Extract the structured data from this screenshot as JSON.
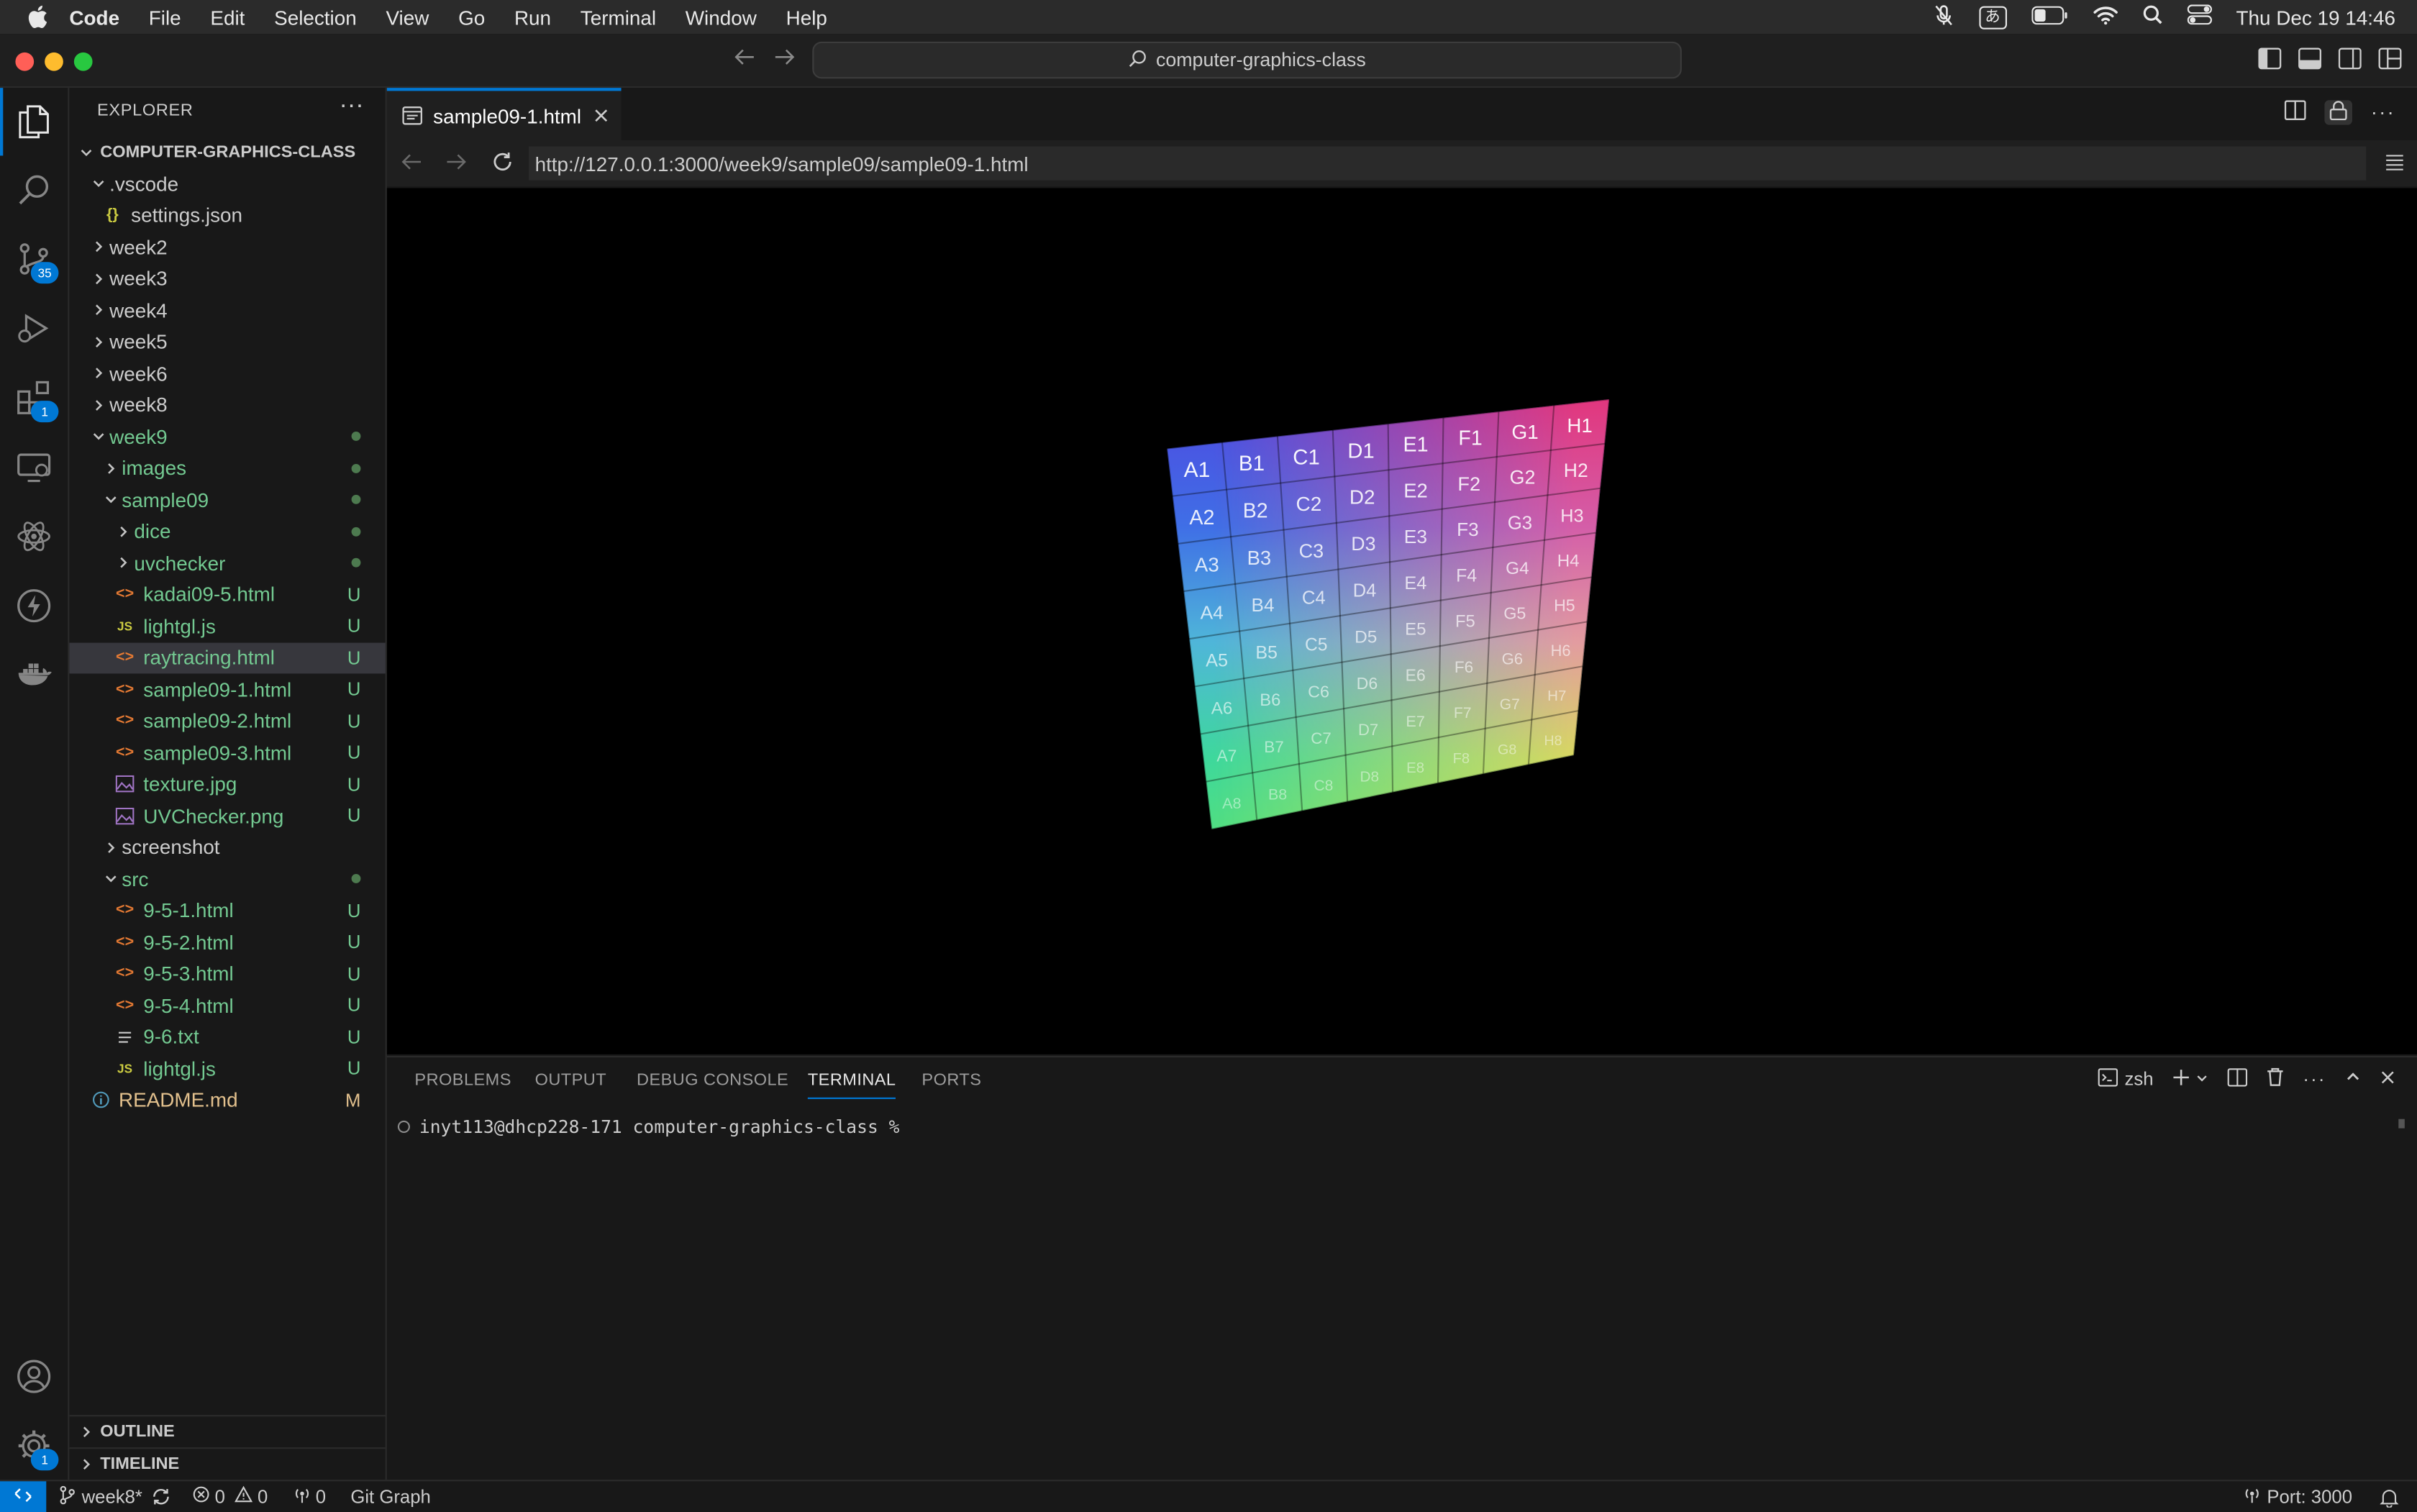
{
  "menubar": {
    "items": [
      "Code",
      "File",
      "Edit",
      "Selection",
      "View",
      "Go",
      "Run",
      "Terminal",
      "Window",
      "Help"
    ],
    "input_indicator": "あ",
    "clock": "Thu Dec 19  14:46"
  },
  "titlebar": {
    "search_text": "computer-graphics-class"
  },
  "activity": {
    "scm_badge": "35",
    "extensions_badge": "1",
    "settings_badge": "1"
  },
  "explorer": {
    "title": "EXPLORER",
    "more": "···",
    "root": "COMPUTER-GRAPHICS-CLASS",
    "items": [
      {
        "label": ".vscode",
        "status": ""
      },
      {
        "label": "settings.json",
        "status": ""
      },
      {
        "label": "week2",
        "status": ""
      },
      {
        "label": "week3",
        "status": ""
      },
      {
        "label": "week4",
        "status": ""
      },
      {
        "label": "week5",
        "status": ""
      },
      {
        "label": "week6",
        "status": ""
      },
      {
        "label": "week8",
        "status": ""
      },
      {
        "label": "week9",
        "status": "•"
      },
      {
        "label": "images",
        "status": "•"
      },
      {
        "label": "sample09",
        "status": "•"
      },
      {
        "label": "dice",
        "status": "•"
      },
      {
        "label": "uvchecker",
        "status": "•"
      },
      {
        "label": "kadai09-5.html",
        "status": "U"
      },
      {
        "label": "lightgl.js",
        "status": "U"
      },
      {
        "label": "raytracing.html",
        "status": "U"
      },
      {
        "label": "sample09-1.html",
        "status": "U"
      },
      {
        "label": "sample09-2.html",
        "status": "U"
      },
      {
        "label": "sample09-3.html",
        "status": "U"
      },
      {
        "label": "texture.jpg",
        "status": "U"
      },
      {
        "label": "UVChecker.png",
        "status": "U"
      },
      {
        "label": "screenshot",
        "status": ""
      },
      {
        "label": "src",
        "status": "•"
      },
      {
        "label": "9-5-1.html",
        "status": "U"
      },
      {
        "label": "9-5-2.html",
        "status": "U"
      },
      {
        "label": "9-5-3.html",
        "status": "U"
      },
      {
        "label": "9-5-4.html",
        "status": "U"
      },
      {
        "label": "9-6.txt",
        "status": "U"
      },
      {
        "label": "lightgl.js",
        "status": "U"
      },
      {
        "label": "README.md",
        "status": "M"
      }
    ],
    "outline": "OUTLINE",
    "timeline": "TIMELINE"
  },
  "editor": {
    "tab_label": "sample09-1.html",
    "url": "http://127.0.0.1:3000/week9/sample09/sample09-1.html"
  },
  "uv_grid": {
    "columns": [
      "A",
      "B",
      "C",
      "D",
      "E",
      "F",
      "G",
      "H"
    ],
    "rows": [
      "1",
      "2",
      "3",
      "4",
      "5",
      "6",
      "7",
      "8"
    ]
  },
  "panel": {
    "tabs": [
      "PROBLEMS",
      "OUTPUT",
      "DEBUG CONSOLE",
      "TERMINAL",
      "PORTS"
    ],
    "shell": "zsh",
    "prompt": "inyt113@dhcp228-171 computer-graphics-class %"
  },
  "statusbar": {
    "branch": "week8*",
    "errors": "0",
    "warnings": "0",
    "ports_count": "0",
    "git_graph": "Git Graph",
    "port": "Port: 3000"
  }
}
